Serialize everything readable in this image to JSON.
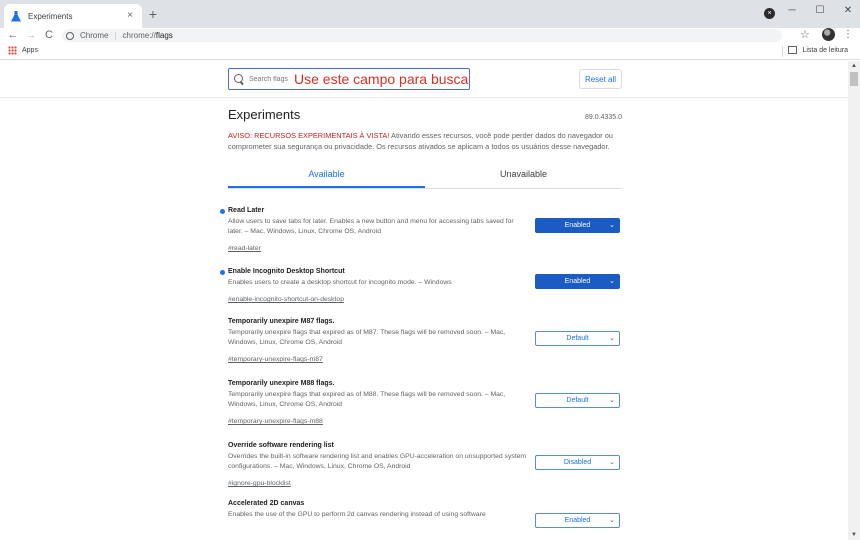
{
  "browser": {
    "tab_title": "Experiments",
    "tab_close": "×",
    "new_tab": "+",
    "profile_badge": "×",
    "window_controls": {
      "minimize": "─",
      "maximize": "☐",
      "close": "✕"
    },
    "nav": {
      "back": "←",
      "forward": "→",
      "reload": "C"
    },
    "omnibox": {
      "scheme_label": "Chrome",
      "separator": "|",
      "url_prefix": "chrome://",
      "url_host": "flags"
    },
    "star": "☆",
    "menu": "⋮"
  },
  "bookmarks_bar": {
    "apps_label": "Apps",
    "reading_list_label": "Lista de leitura"
  },
  "search": {
    "placeholder": "Search flags",
    "annotation": "Use este campo para busca",
    "reset_label": "Reset all"
  },
  "main": {
    "title": "Experiments",
    "version": "89.0.4335.0",
    "warning_red": "AVISO: RECURSOS EXPERIMENTAIS À VISTA!",
    "warning_text": " Ativando esses recursos, você pode perder dados do navegador ou comprometer sua segurança ou privacidade. Os recursos ativados se aplicam a todos os usuários desse navegador.",
    "tabs": [
      {
        "label": "Available",
        "active": true
      },
      {
        "label": "Unavailable",
        "active": false
      }
    ]
  },
  "flags": [
    {
      "name": "Read Later",
      "description": "Allow users to save tabs for later. Enables a new button and menu for accessing tabs saved for later. – Mac, Windows, Linux, Chrome OS, Android",
      "link": "#read-later",
      "state": "Enabled",
      "modified": true
    },
    {
      "name": "Enable Incognito Desktop Shortcut",
      "description": "Enables users to create a desktop shortcut for incognito mode. – Windows",
      "link": "#enable-incognito-shortcut-on-desktop",
      "state": "Enabled",
      "modified": true
    },
    {
      "name": "Temporarily unexpire M87 flags.",
      "description": "Temporarily unexpire flags that expired as of M87. These flags will be removed soon. – Mac, Windows, Linux, Chrome OS, Android",
      "link": "#temporary-unexpire-flags-m87",
      "state": "Default",
      "modified": false
    },
    {
      "name": "Temporarily unexpire M88 flags.",
      "description": "Temporarily unexpire flags that expired as of M88. These flags will be removed soon. – Mac, Windows, Linux, Chrome OS, Android",
      "link": "#temporary-unexpire-flags-m88",
      "state": "Default",
      "modified": false
    },
    {
      "name": "Override software rendering list",
      "description": "Overrides the built-in software rendering list and enables GPU-acceleration on unsupported system configurations. – Mac, Windows, Linux, Chrome OS, Android",
      "link": "#ignore-gpu-blocklist",
      "state": "Disabled",
      "modified": false
    },
    {
      "name": "Accelerated 2D canvas",
      "description": "Enables the use of the GPU to perform 2d canvas rendering instead of using software",
      "link": "",
      "state": "Enabled",
      "modified": false
    }
  ],
  "colors": {
    "accent": "#1a73e8",
    "enabled_select": "#1a5cc4",
    "warning_red": "#c5221f",
    "annotation_red": "#d93025"
  }
}
